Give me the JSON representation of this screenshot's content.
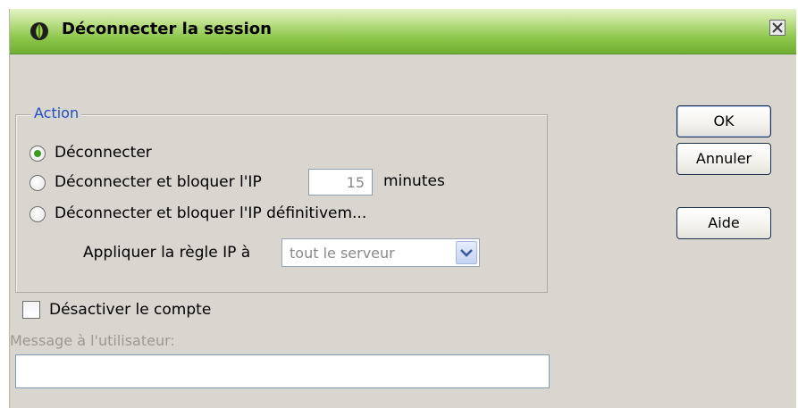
{
  "window": {
    "title": "Déconnecter la session",
    "close_glyph": "✕"
  },
  "action_group": {
    "legend": "Action",
    "options": [
      {
        "label": "Déconnecter",
        "checked": true
      },
      {
        "label": "Déconnecter et bloquer l'IP",
        "checked": false
      },
      {
        "label": "Déconnecter et bloquer l'IP définitivem...",
        "checked": false
      }
    ],
    "block_minutes_value": "15",
    "minutes_label": "minutes",
    "rule_label": "Appliquer la règle IP à",
    "rule_select_value": "tout le serveur"
  },
  "disable_account": {
    "label": "Désactiver le compte",
    "checked": false
  },
  "message": {
    "label": "Message à l'utilisateur:",
    "value": ""
  },
  "buttons": {
    "ok": "OK",
    "cancel": "Annuler",
    "help": "Aide"
  },
  "colors": {
    "titlebar_green": "#8dc64b",
    "legend_blue": "#1f4fbf",
    "radio_green": "#3d9b1f",
    "dialog_bg": "#d9d5cf"
  },
  "icons": {
    "app": "green-leaf-icon",
    "close": "close-icon",
    "dropdown": "chevron-down-icon"
  }
}
